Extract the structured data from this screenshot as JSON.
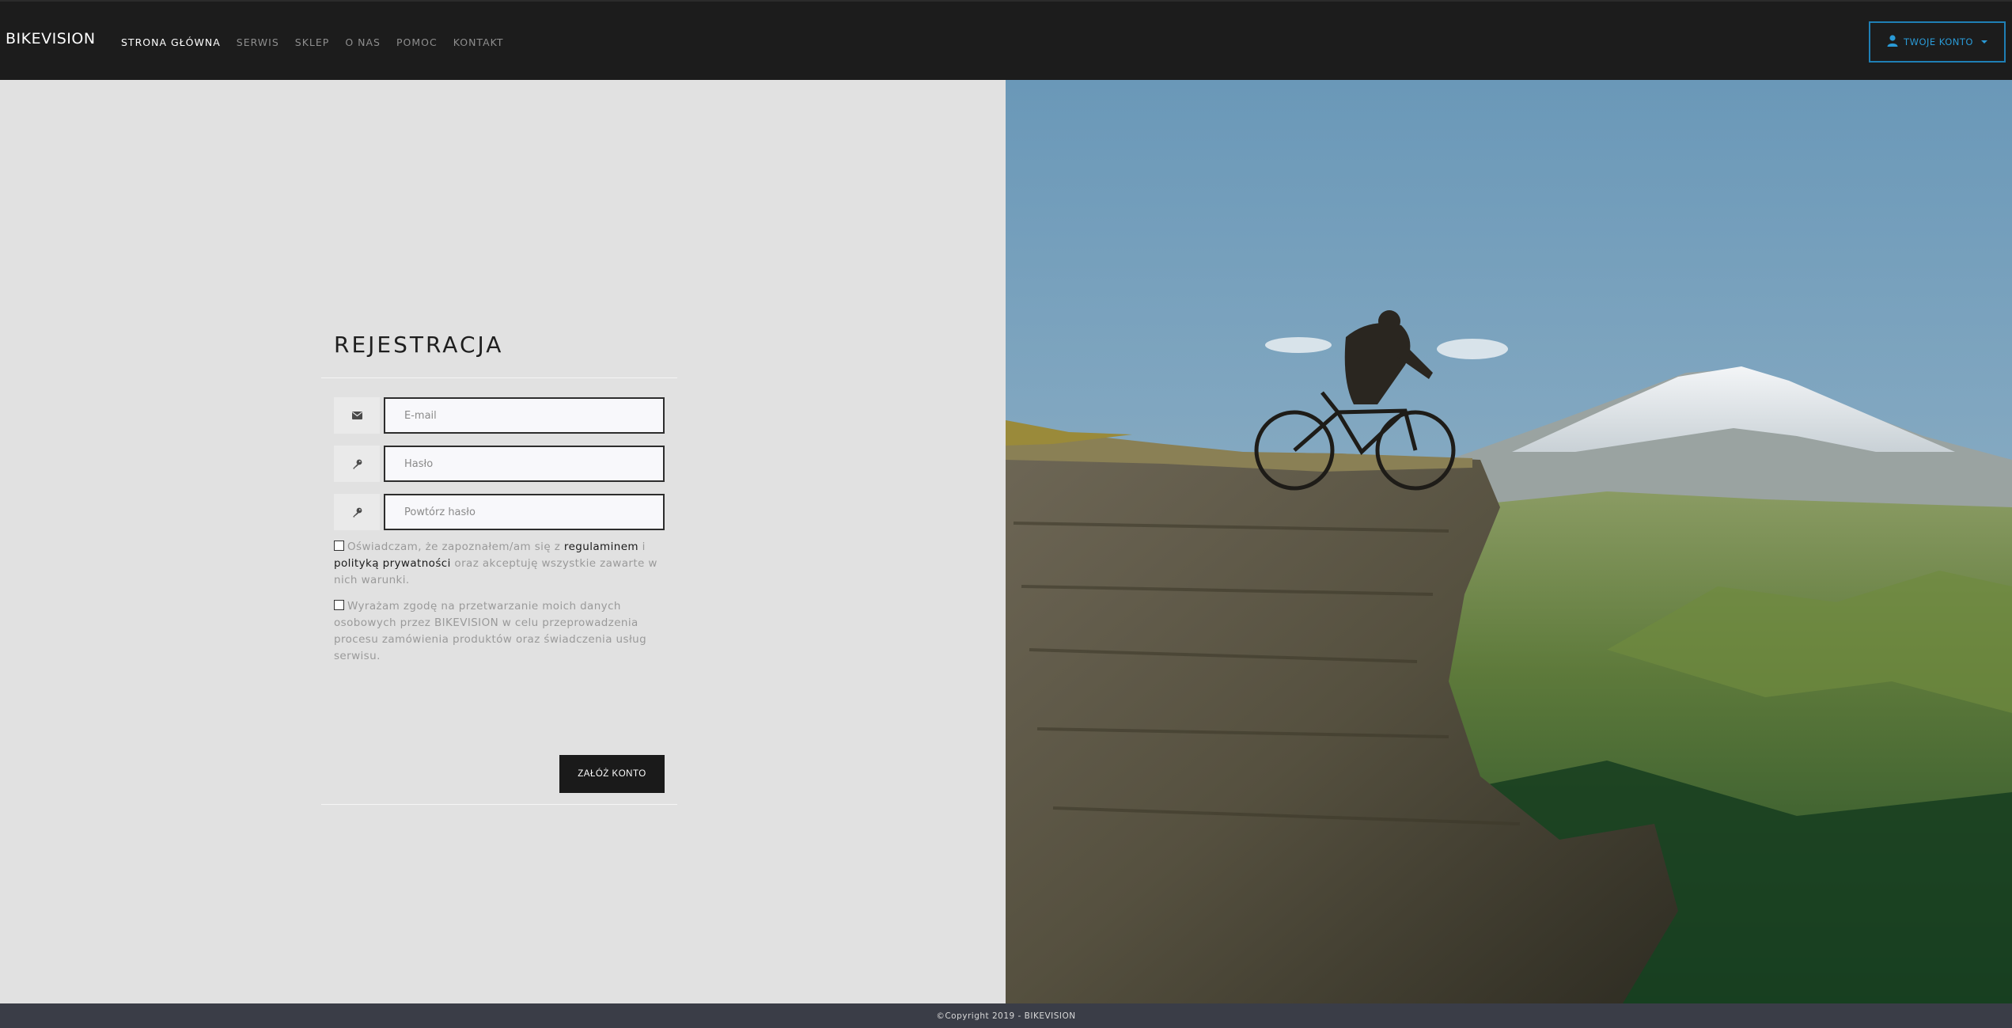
{
  "navbar": {
    "brand": "BIKEVISION",
    "links": [
      {
        "label": "STRONA GŁÓWNA",
        "active": true
      },
      {
        "label": "SERWIS",
        "active": false
      },
      {
        "label": "SKLEP",
        "active": false
      },
      {
        "label": "O NAS",
        "active": false
      },
      {
        "label": "POMOC",
        "active": false
      },
      {
        "label": "KONTAKT",
        "active": false
      }
    ],
    "account_label": "TWOJE KONTO",
    "account_icon": "user-icon",
    "accent_color": "#2a9ad6"
  },
  "form": {
    "title": "REJESTRACJA",
    "email": {
      "placeholder": "E-mail",
      "value": "",
      "icon": "envelope-icon"
    },
    "password": {
      "placeholder": "Hasło",
      "value": "",
      "icon": "key-icon"
    },
    "password_repeat": {
      "placeholder": "Powtórz hasło",
      "value": "",
      "icon": "key-icon"
    },
    "terms": {
      "checked": false,
      "text_1": "Oświadczam, że zapoznałem/am się z ",
      "link_1": "regulaminem",
      "text_2": " i ",
      "link_2": "polityką prywatności",
      "text_3": " oraz akceptuję wszystkie zawarte w nich warunki."
    },
    "consent": {
      "checked": false,
      "text": "Wyrażam zgodę na przetwarzanie moich danych osobowych przez BIKEVISION w celu przeprowadzenia procesu zamówienia produktów oraz świadczenia usług serwisu."
    },
    "submit_label": "ZAŁÓŻ KONTO"
  },
  "footer": {
    "copyright": "©Copyright 2019 - BIKEVISION"
  }
}
